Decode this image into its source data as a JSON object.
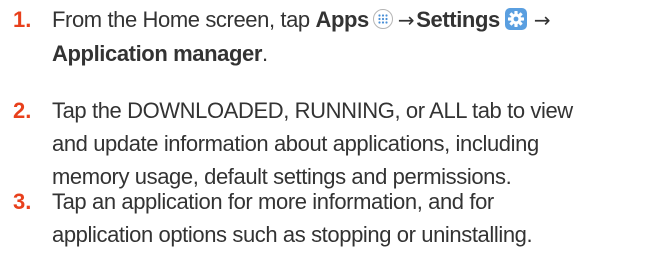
{
  "steps": [
    {
      "number": "1.",
      "line1_pre": "From the Home screen, tap ",
      "apps_label": "Apps",
      "arrow1": "→",
      "settings_label": "Settings",
      "arrow2": "→",
      "app_manager_label": "Application manager",
      "period": ".",
      "icons": [
        "apps-grid-icon",
        "settings-gear-icon"
      ]
    },
    {
      "number": "2.",
      "lines": [
        "Tap the DOWNLOADED, RUNNING, or ALL tab to view",
        "and update information about applications, including",
        "memory usage, default settings and permissions."
      ]
    },
    {
      "number": "3.",
      "lines": [
        "Tap an application for more information, and for",
        "application options such as stopping or uninstalling."
      ]
    }
  ],
  "colors": {
    "step_number": "#e8401c",
    "body_text": "#333333",
    "icon_blue": "#4a8fd6"
  }
}
